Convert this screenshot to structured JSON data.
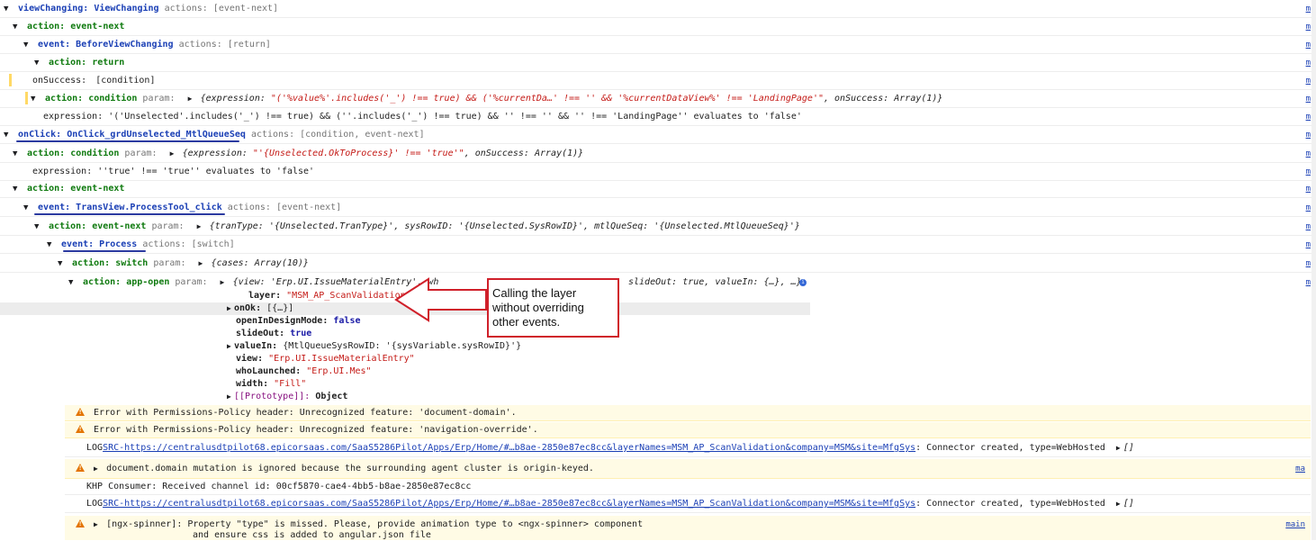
{
  "rows": {
    "r1": {
      "label": "viewChanging: ViewChanging",
      "actions": "actions: [event-next]"
    },
    "r2": {
      "label": "action: event-next"
    },
    "r3": {
      "label": "event: BeforeViewChanging",
      "actions": "actions: [return]"
    },
    "r4": {
      "label": "action: return"
    },
    "r5": {
      "key": "onSuccess:",
      "value": "[condition]"
    },
    "r6": {
      "label": "action: condition",
      "param": "param:",
      "expr_a": "{expression: ",
      "expr_str": "\"('%value%'.includes('_') !== true) && ('%currentDa…' !== '' && '%currentDataView%' !== 'LandingPage'\"",
      "expr_b": ", onSuccess: ",
      "expr_c": "Array(1)}"
    },
    "r7": {
      "text": "expression: '('Unselected'.includes('_') !== true) && (''.includes('_') !== true) && '' !== '' && '' !== 'LandingPage'' evaluates to 'false'"
    },
    "r8": {
      "label": "onClick: OnClick_grdUnselected_MtlQueueSeq",
      "actions": "actions: [condition, event-next]"
    },
    "r9": {
      "label": "action: condition",
      "param": "param:",
      "expr_a": "{expression: ",
      "expr_str": "\"'{Unselected.OkToProcess}' !== 'true'\"",
      "expr_b": ", onSuccess: ",
      "expr_c": "Array(1)}"
    },
    "r10": {
      "text": "expression: ''true' !== 'true'' evaluates to 'false'"
    },
    "r11": {
      "label": "action: event-next"
    },
    "r12": {
      "label": "event: TransView.ProcessTool_click",
      "actions": "actions: [event-next]"
    },
    "r13": {
      "label": "action: event-next",
      "param": "param:",
      "detail": "{tranType: '{Unselected.TranType}', sysRowID: '{Unselected.SysRowID}', mtlQueSeq: '{Unselected.MtlQueueSeq}'}"
    },
    "r14": {
      "label": "event: Process",
      "actions": "actions: [switch]"
    },
    "r15": {
      "label": "action: switch",
      "param": "param:",
      "detail": "{cases: Array(10)}"
    },
    "r16": {
      "label": "action: app-open",
      "param": "param:",
      "detail_a": "{view: 'Erp.UI.IssueMaterialEntry', wh",
      "detail_b": "slideOut: true, valueIn: {…}, …}"
    }
  },
  "props": {
    "layer_k": "layer:",
    "layer_v": "\"MSM_AP_ScanValidation\"",
    "onok_k": "onOk:",
    "onok_v": "[{…}]",
    "oidm_k": "openInDesignMode:",
    "oidm_v": "false",
    "slide_k": "slideOut:",
    "slide_v": "true",
    "valuein_k": "valueIn:",
    "valuein_v": "{MtlQueueSysRowID: '{sysVariable.sysRowID}'}",
    "view_k": "view:",
    "view_v": "\"Erp.UI.IssueMaterialEntry\"",
    "who_k": "whoLaunched:",
    "who_v": "\"Erp.UI.Mes\"",
    "width_k": "width:",
    "width_v": "\"Fill\"",
    "proto_k": "[[Prototype]]:",
    "proto_v": "Object"
  },
  "callout": {
    "line1": "Calling the layer",
    "line2": "without overriding",
    "line3": "other events."
  },
  "console": {
    "w1": "Error with Permissions-Policy header: Unrecognized feature: 'document-domain'.",
    "w2": "Error with Permissions-Policy header: Unrecognized feature: 'navigation-override'.",
    "log1_pre": "LOG",
    "log1_link": "SRC-https://centralusdtpilot68.epicorsaas.com/SaaS5286Pilot/Apps/Erp/Home/#…b8ae-2850e87ec8cc&layerNames=MSM_AP_ScanValidation&company=MSM&site=MfgSys",
    "log1_post": ": Connector created, type=WebHosted",
    "log1_arr": "[]",
    "w3": "document.domain mutation is ignored because the surrounding agent cluster is origin-keyed.",
    "w3_src": "ma",
    "khp": "KHP Consumer: Received channel id: 00cf5870-cae4-4bb5-b8ae-2850e87ec8cc",
    "log2_pre": "LOG",
    "log2_link": "SRC-https://centralusdtpilot68.epicorsaas.com/SaaS5286Pilot/Apps/Erp/Home/#…b8ae-2850e87ec8cc&layerNames=MSM_AP_ScanValidation&company=MSM&site=MfgSys",
    "log2_post": ": Connector created, type=WebHosted",
    "log2_arr": "[]",
    "w4": "[ngx-spinner]: Property \"type\" is missed. Please, provide animation type to <ngx-spinner> component",
    "w4b": "and ensure css is added to angular.json file",
    "w4_src": "main"
  },
  "src_label": "m"
}
